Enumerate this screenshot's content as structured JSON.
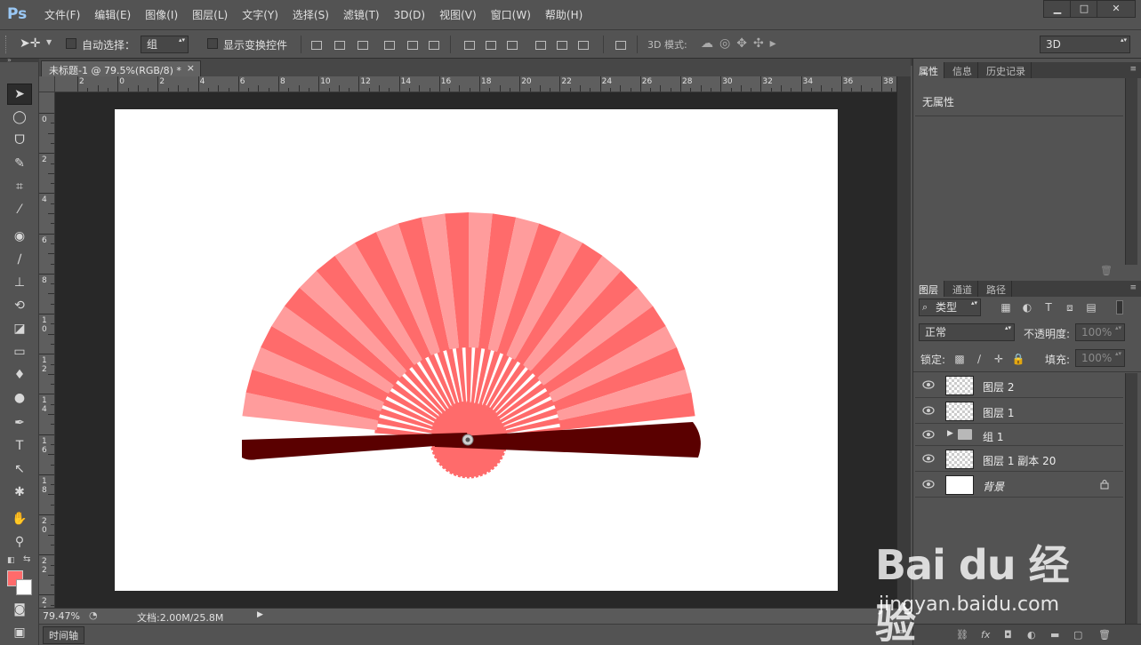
{
  "app": {
    "logo": "Ps"
  },
  "menu": [
    "文件(F)",
    "编辑(E)",
    "图像(I)",
    "图层(L)",
    "文字(Y)",
    "选择(S)",
    "滤镜(T)",
    "3D(D)",
    "视图(V)",
    "窗口(W)",
    "帮助(H)"
  ],
  "window_controls": {
    "minimize": "▁",
    "maximize": "□",
    "close": "✕"
  },
  "options": {
    "auto_select_label": "自动选择：",
    "auto_select_value": "组",
    "show_transform_label": "显示变换控件",
    "mode_3d_label": "3D 模式:",
    "workspace_value": "3D"
  },
  "document": {
    "tab_title": "未标题-1 @ 79.5%(RGB/8) *",
    "close": "×"
  },
  "ruler": {
    "h_labels": [
      "2",
      "0",
      "2",
      "4",
      "6",
      "8",
      "10",
      "12",
      "14",
      "16",
      "18",
      "20",
      "22",
      "24",
      "26",
      "28",
      "30",
      "32",
      "34",
      "36",
      "38"
    ],
    "v_labels": [
      "0",
      "2",
      "4",
      "6",
      "8",
      "10",
      "12",
      "14",
      "16",
      "18",
      "20",
      "22",
      "24"
    ]
  },
  "status": {
    "zoom": "79.47%",
    "doc_info": "文档:2.00M/25.8M",
    "arrow": "▶"
  },
  "timeline": {
    "label": "时间轴"
  },
  "properties_panel": {
    "tabs": [
      "属性",
      "信息",
      "历史记录"
    ],
    "content": "无属性"
  },
  "layers_panel": {
    "tabs": [
      "图层",
      "通道",
      "路径"
    ],
    "filter_kind": "类型",
    "blend_mode": "正常",
    "opacity_label": "不透明度:",
    "opacity_value": "100%",
    "lock_label": "锁定:",
    "fill_label": "填充:",
    "fill_value": "100%",
    "layers": [
      {
        "name": "图层 2",
        "type": "layer"
      },
      {
        "name": "图层 1",
        "type": "layer"
      },
      {
        "name": "组 1",
        "type": "group"
      },
      {
        "name": "图层 1 副本 20",
        "type": "layer"
      },
      {
        "name": "背景",
        "type": "background"
      }
    ]
  },
  "tool_icons": [
    "move-tool-icon",
    "ellipse-marquee-icon",
    "lasso-icon",
    "quick-select-icon",
    "crop-icon",
    "eyedropper-icon",
    "healing-brush-icon",
    "brush-icon",
    "stamp-icon",
    "history-brush-icon",
    "eraser-icon",
    "gradient-icon",
    "blur-icon",
    "dodge-icon",
    "pen-icon",
    "type-icon",
    "path-select-icon",
    "shape-icon",
    "hand-icon",
    "zoom-icon"
  ],
  "colors": {
    "foreground": "#ff6b6b",
    "background": "#ffffff",
    "fan_light": "#ff9c9c",
    "fan_dark": "#ff6b6b",
    "handle": "#5a0000"
  },
  "watermark": {
    "brand": "Bai du 经验",
    "url": "jingyan.baidu.com"
  }
}
